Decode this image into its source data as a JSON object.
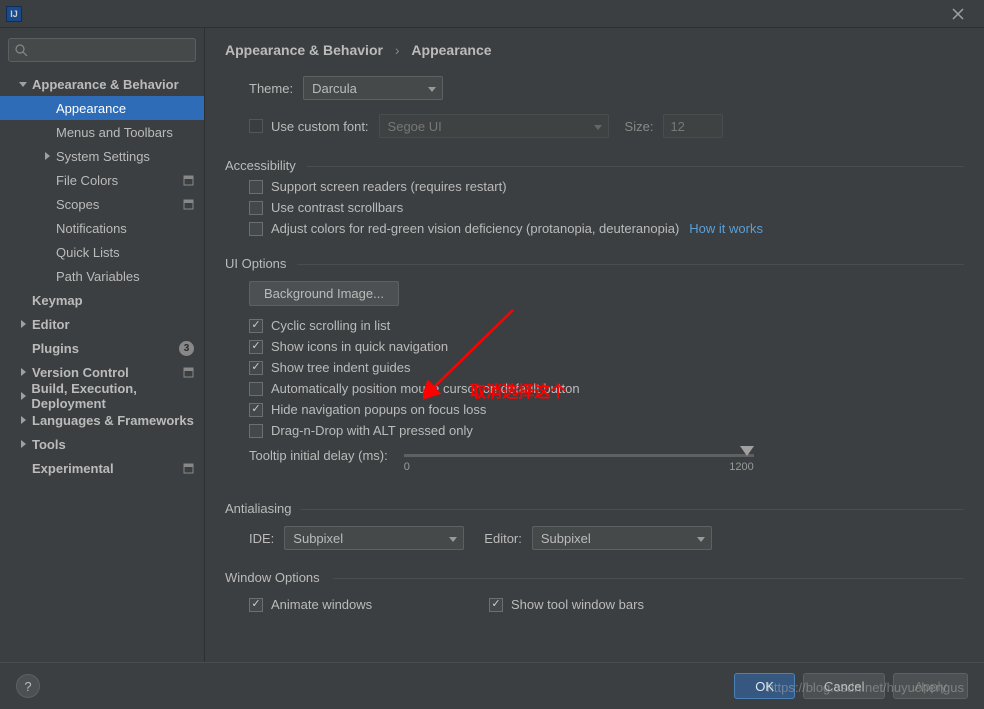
{
  "window": {
    "animate": "Animate windows",
    "show_tool_bars": "Show tool window bars"
  },
  "sidebar": {
    "items": [
      {
        "label": "Appearance & Behavior"
      },
      {
        "label": "Appearance"
      },
      {
        "label": "Menus and Toolbars"
      },
      {
        "label": "System Settings"
      },
      {
        "label": "File Colors"
      },
      {
        "label": "Scopes"
      },
      {
        "label": "Notifications"
      },
      {
        "label": "Quick Lists"
      },
      {
        "label": "Path Variables"
      },
      {
        "label": "Keymap"
      },
      {
        "label": "Editor"
      },
      {
        "label": "Plugins"
      },
      {
        "label": "Version Control"
      },
      {
        "label": "Build, Execution, Deployment"
      },
      {
        "label": "Languages & Frameworks"
      },
      {
        "label": "Tools"
      },
      {
        "label": "Experimental"
      }
    ],
    "plugins_count": "3"
  },
  "breadcrumb": {
    "main": "Appearance & Behavior",
    "sub": "Appearance"
  },
  "theme": {
    "label": "Theme:",
    "value": "Darcula"
  },
  "font": {
    "use_custom_label": "Use custom font:",
    "value": "Segoe UI",
    "size_label": "Size:",
    "size_value": "12"
  },
  "sections": {
    "accessibility": "Accessibility",
    "ui_options": "UI Options",
    "antialiasing": "Antialiasing",
    "window_options": "Window Options"
  },
  "accessibility": {
    "screen_readers": "Support screen readers (requires restart)",
    "contrast_scrollbars": "Use contrast scrollbars",
    "color_def": "Adjust colors for red-green vision deficiency (protanopia, deuteranopia)",
    "how_link": "How it works"
  },
  "ui": {
    "bg_image_btn": "Background Image...",
    "cyclic": "Cyclic scrolling in list",
    "show_icons": "Show icons in quick navigation",
    "tree_guides": "Show tree indent guides",
    "auto_mouse": "Automatically position mouse cursor on default button",
    "hide_popups": "Hide navigation popups on focus loss",
    "dnd_alt": "Drag-n-Drop with ALT pressed only",
    "tooltip_label": "Tooltip initial delay (ms):",
    "tooltip_min": "0",
    "tooltip_max": "1200"
  },
  "antialiasing": {
    "ide_label": "IDE:",
    "ide_value": "Subpixel",
    "editor_label": "Editor:",
    "editor_value": "Subpixel"
  },
  "footer": {
    "ok": "OK",
    "cancel": "Cancel",
    "apply": "Apply"
  },
  "annotation": "取消选择这个",
  "watermark_text": "https://blog.csdn.net/huyuchengus"
}
